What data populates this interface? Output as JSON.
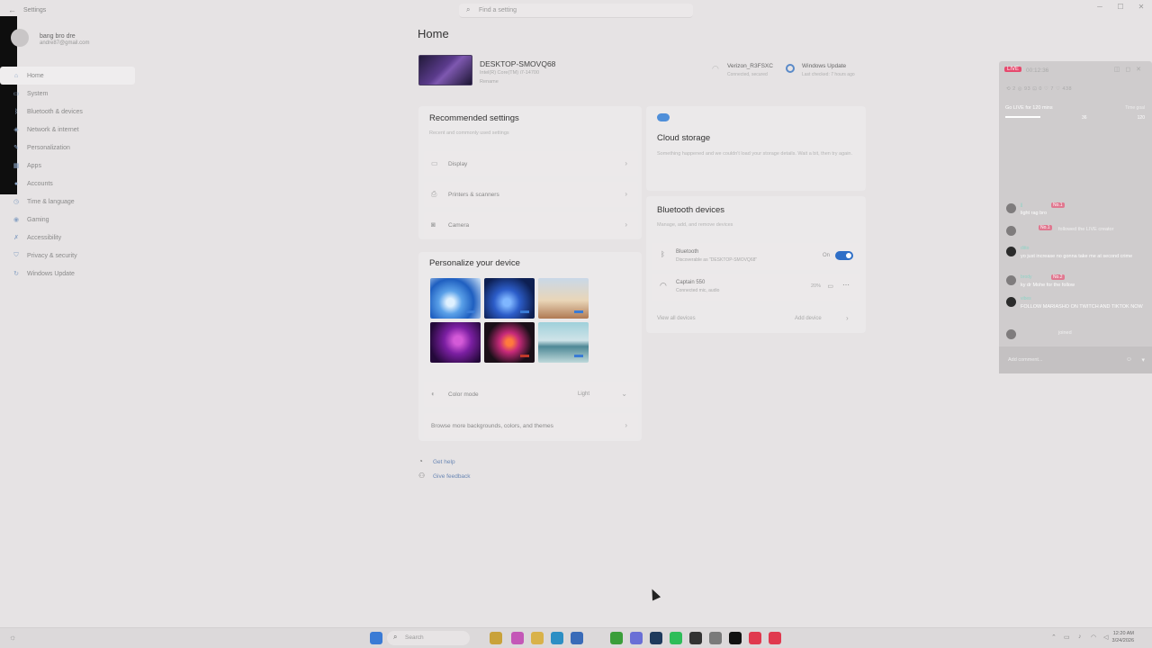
{
  "window": {
    "app_title": "Settings",
    "search_placeholder": "Find a setting",
    "minimize": "─",
    "maximize": "☐",
    "close": "✕"
  },
  "user": {
    "name": "bang bro dre",
    "email": "andre87@gmail.com"
  },
  "nav": [
    {
      "label": "Home",
      "icon": "home-icon",
      "glyph": "⌂",
      "active": true
    },
    {
      "label": "System",
      "icon": "monitor-icon",
      "glyph": "▭"
    },
    {
      "label": "Bluetooth & devices",
      "icon": "bluetooth-icon",
      "glyph": "ᛒ"
    },
    {
      "label": "Network & internet",
      "icon": "network-icon",
      "glyph": "◈"
    },
    {
      "label": "Personalization",
      "icon": "brush-icon",
      "glyph": "✎"
    },
    {
      "label": "Apps",
      "icon": "apps-icon",
      "glyph": "▦"
    },
    {
      "label": "Accounts",
      "icon": "person-icon",
      "glyph": "●"
    },
    {
      "label": "Time & language",
      "icon": "globe-icon",
      "glyph": "◷"
    },
    {
      "label": "Gaming",
      "icon": "gamepad-icon",
      "glyph": "◉"
    },
    {
      "label": "Accessibility",
      "icon": "accessibility-icon",
      "glyph": "✗"
    },
    {
      "label": "Privacy & security",
      "icon": "shield-icon",
      "glyph": "⛉"
    },
    {
      "label": "Windows Update",
      "icon": "update-icon",
      "glyph": "↻"
    }
  ],
  "main": {
    "title": "Home",
    "device": {
      "name": "DESKTOP-SMOVQ68",
      "spec": "Intel(R) Core(TM) i7-14700",
      "rename": "Rename"
    },
    "network": {
      "name": "Verizon_R3FSXC",
      "status": "Connected, secured"
    },
    "update": {
      "name": "Windows Update",
      "status": "Last checked: 7 hours ago"
    },
    "recommended": {
      "title": "Recommended settings",
      "subtitle": "Recent and commonly used settings",
      "items": [
        {
          "label": "Display",
          "glyph": "▭"
        },
        {
          "label": "Printers & scanners",
          "glyph": "⎙"
        },
        {
          "label": "Camera",
          "glyph": "◙"
        }
      ]
    },
    "personalize": {
      "title": "Personalize your device",
      "color_mode_label": "Color mode",
      "color_mode_value": "Light",
      "browse_label": "Browse more backgrounds, colors, and themes"
    },
    "help": {
      "get_help": "Get help",
      "feedback": "Give feedback"
    },
    "cloud": {
      "title": "Cloud storage",
      "message": "Something happened and we couldn't load your storage details. Wait a bit, then try again."
    },
    "bluetooth": {
      "title": "Bluetooth devices",
      "subtitle": "Manage, add, and remove devices",
      "bt_label": "Bluetooth",
      "bt_sub": "Discoverable as \"DESKTOP-SMOVQ68\"",
      "bt_state": "On",
      "device_name": "Captain 550",
      "device_status": "Connected mic, audio",
      "device_battery": "20%",
      "view_all": "View all devices",
      "add_device": "Add device"
    }
  },
  "live": {
    "badge": "LIVE",
    "time": "00:12:36",
    "stats": "⟲ 2    ◎ 93    ⊡ 0    ♡ 7    ♡ 438",
    "goal": "Go LIVE for 120 mins",
    "goal_right": "Time goal",
    "progress": 0.3,
    "goal_current": "36",
    "goal_target": "120",
    "chat": [
      {
        "name": "jj",
        "badge": "No.1",
        "text": "light rag bro",
        "dark": false
      },
      {
        "name": "",
        "badge": "No.1",
        "text": "followed the LIVE creator",
        "dark": false,
        "system": true
      },
      {
        "name": "ditto",
        "badge": "",
        "text": "yo just increase no gonna take me at second crime",
        "dark": true
      },
      {
        "name": "brody",
        "badge": "No.2",
        "text": "ky dr Mohe for the follow",
        "dark": false
      },
      {
        "name": "vibes",
        "badge": "",
        "text": "FOLLOW MARIASHO ON TWITCH AND TIKTOK NOW",
        "dark": true
      },
      {
        "name": "",
        "badge": "",
        "text": "joined",
        "dark": false,
        "system": true
      }
    ],
    "input_placeholder": "Add comment..."
  },
  "taskbar": {
    "search_placeholder": "Search",
    "time": "12:20 AM",
    "date": "3/24/2026",
    "apps": [
      {
        "name": "start-icon",
        "color": "#3a7bd5"
      },
      {
        "name": "file-explorer-icon",
        "color": "#c9a23a"
      },
      {
        "name": "copilot-icon",
        "color": "#c458b7"
      },
      {
        "name": "folder-icon",
        "color": "#d9b24a"
      },
      {
        "name": "edge-icon",
        "color": "#2d8fc4"
      },
      {
        "name": "store-icon",
        "color": "#3a6bb8"
      },
      {
        "name": "minecraft-icon",
        "color": "#3b9e3a"
      },
      {
        "name": "discord-icon",
        "color": "#6a6fd6"
      },
      {
        "name": "steam-icon",
        "color": "#1f3a5c"
      },
      {
        "name": "spotify-icon",
        "color": "#2ebd59"
      },
      {
        "name": "obs-icon",
        "color": "#333333"
      },
      {
        "name": "settings-icon",
        "color": "#7a7a7a"
      },
      {
        "name": "capcut-icon",
        "color": "#111111"
      },
      {
        "name": "tiktok-live-icon",
        "color": "#e0394e"
      },
      {
        "name": "tiktok-icon",
        "color": "#e0394e"
      }
    ]
  }
}
